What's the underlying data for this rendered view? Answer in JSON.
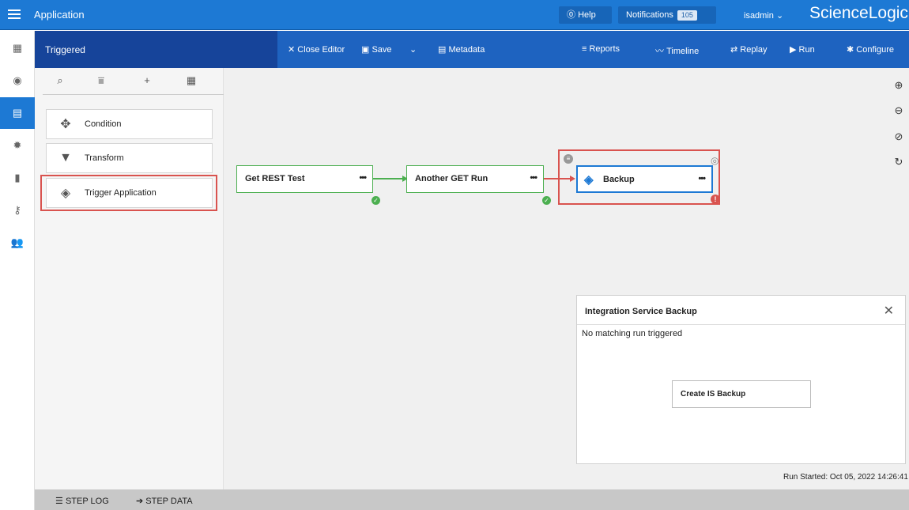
{
  "topbar": {
    "app_title": "Application",
    "help_label": "Help",
    "notifications_label": "Notifications",
    "notifications_count": "105",
    "user_label": "isadmin",
    "logo_text": "ScienceLogic"
  },
  "subbar": {
    "title": "Triggered",
    "close_editor": "Close Editor",
    "save": "Save",
    "metadata": "Metadata",
    "reports": "Reports",
    "timeline": "Timeline",
    "replay": "Replay",
    "run": "Run",
    "configure": "Configure"
  },
  "palette": {
    "items": [
      {
        "label": "Condition",
        "icon": "move-arrows-icon"
      },
      {
        "label": "Transform",
        "icon": "funnel-icon"
      },
      {
        "label": "Trigger Application",
        "icon": "layers-icon"
      }
    ]
  },
  "canvas": {
    "nodes": [
      {
        "label": "Get REST Test",
        "status": "success"
      },
      {
        "label": "Another GET Run",
        "status": "success"
      },
      {
        "label": "Backup",
        "status": "error"
      }
    ]
  },
  "panel": {
    "title": "Integration Service Backup",
    "message": "No matching run triggered",
    "button": "Create IS Backup"
  },
  "run_started": "Run Started: Oct 05, 2022 14:26:41",
  "bottom": {
    "step_log": "STEP LOG",
    "step_data": "STEP DATA"
  },
  "colors": {
    "primary": "#1d79d4",
    "subbar": "#1e63c0",
    "success": "#4caf50",
    "error": "#d9534f"
  }
}
